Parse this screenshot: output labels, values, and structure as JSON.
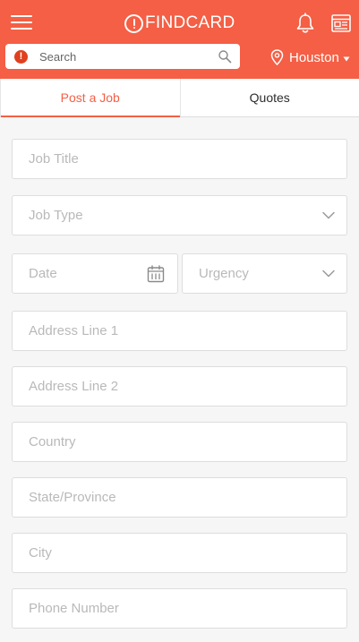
{
  "app": {
    "brand": "FINDCARD"
  },
  "header": {
    "search": {
      "badge": "!",
      "placeholder": "Search"
    },
    "location": {
      "label": "Houston"
    }
  },
  "tabs": [
    {
      "label": "Post a Job",
      "active": true
    },
    {
      "label": "Quotes",
      "active": false
    }
  ],
  "form": {
    "job_title": {
      "placeholder": "Job Title"
    },
    "job_type": {
      "placeholder": "Job Type"
    },
    "date": {
      "placeholder": "Date"
    },
    "urgency": {
      "placeholder": "Urgency"
    },
    "address_line_1": {
      "placeholder": "Address Line 1"
    },
    "address_line_2": {
      "placeholder": "Address Line 2"
    },
    "country": {
      "placeholder": "Country"
    },
    "state_province": {
      "placeholder": "State/Province"
    },
    "city": {
      "placeholder": "City"
    },
    "phone_number": {
      "placeholder": "Phone Number"
    }
  },
  "icons": {
    "menu": "menu-icon",
    "brand": "alert-circle-icon",
    "notifications": "bell-icon",
    "feed": "newspaper-icon",
    "search": "search-icon",
    "location": "location-pin-icon",
    "dropdown": "chevron-down-icon",
    "calendar": "calendar-icon"
  },
  "colors": {
    "brand": "#f45f45",
    "badge": "#e0401f",
    "placeholder": "#b9b9b9",
    "form_background": "#f6f6f6",
    "field_border": "#dddddd"
  }
}
